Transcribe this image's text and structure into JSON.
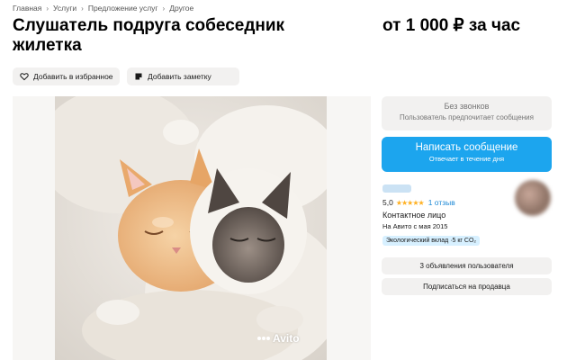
{
  "breadcrumb": [
    "Главная",
    "Услуги",
    "Предложение услуг",
    "Другое"
  ],
  "title": "Слушатель подруга собеседник жилетка",
  "price": "от 1 000 ₽ за час",
  "actions": {
    "favorite_label": "Добавить в избранное",
    "note_label": "Добавить заметку"
  },
  "photo": {
    "watermark": "Avito"
  },
  "contact_panel": {
    "no_calls_title": "Без звонков",
    "no_calls_subtitle": "Пользователь предпочитает сообщения",
    "message_button_label": "Написать сообщение",
    "message_button_subtitle": "Отвечает в течение дня"
  },
  "seller": {
    "rating": "5,0",
    "stars": "★★★★★",
    "reviews": "1 отзыв",
    "contact_type": "Контактное лицо",
    "since": "На Авито с мая 2015",
    "eco_badge": "Экологический вклад ·5 кг CO₂",
    "ads_button_label": "3 объявления пользователя",
    "subscribe_button_label": "Подписаться на продавца"
  },
  "colors": {
    "accent": "#1ca5ee",
    "star": "#ffb021",
    "link": "#1f8ad6",
    "button_bg": "#f2f1f0"
  },
  "icons": {
    "favorite": "heart-icon",
    "note": "note-icon",
    "logo": "avito-logo-icon"
  }
}
